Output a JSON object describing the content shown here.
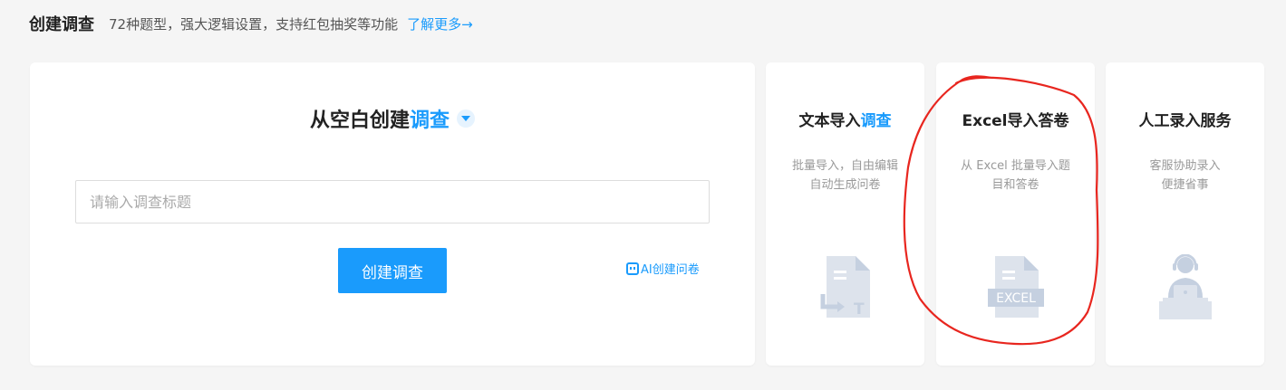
{
  "header": {
    "title": "创建调查",
    "description": "72种题型，强大逻辑设置，支持红包抽奖等功能",
    "learn_more": "了解更多→"
  },
  "main": {
    "title_prefix": "从空白创建",
    "title_accent": "调查",
    "input_placeholder": "请输入调查标题",
    "create_button": "创建调查",
    "ai_link": "AI创建问卷"
  },
  "cards": [
    {
      "title_prefix": "文本导入",
      "title_accent": "调查",
      "desc_line1": "批量导入，自由编辑",
      "desc_line2": "自动生成问卷",
      "icon": "text-import-icon"
    },
    {
      "title_prefix": "Excel导入答卷",
      "title_accent": "",
      "desc_line1": "从 Excel 批量导入题",
      "desc_line2": "目和答卷",
      "icon": "excel-icon",
      "icon_text": "EXCEL"
    },
    {
      "title_prefix": "人工录入服务",
      "title_accent": "",
      "desc_line1": "客服协助录入",
      "desc_line2": "便捷省事",
      "icon": "customer-service-icon"
    }
  ],
  "colors": {
    "accent": "#1a9bfc",
    "icon": "#c5d0e0",
    "annotation": "#e8261f"
  }
}
